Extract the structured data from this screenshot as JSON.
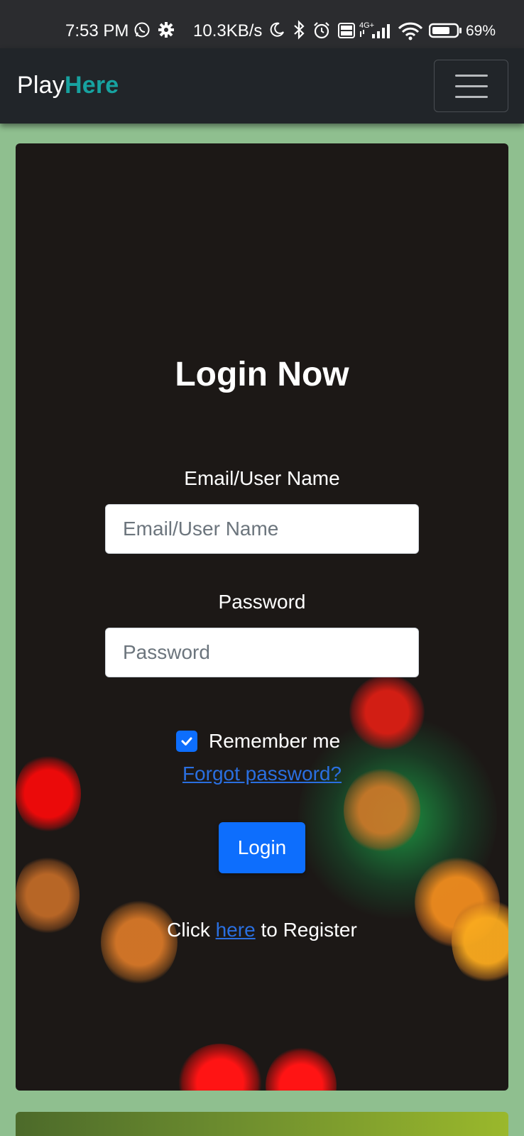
{
  "status_bar": {
    "time": "7:53 PM",
    "speed": "10.3KB/s",
    "network": "4G+",
    "battery": "69%"
  },
  "navbar": {
    "brand_part1": "Play",
    "brand_part2": "Here",
    "accent_color": "#17a2a0"
  },
  "login": {
    "title": "Login Now",
    "email_label": "Email/User Name",
    "email_placeholder": "Email/User Name",
    "password_label": "Password",
    "password_placeholder": "Password",
    "remember_label": "Remember me",
    "remember_checked": true,
    "forgot_link": "Forgot password?",
    "login_button": "Login",
    "register_prefix": "Click",
    "register_link": "here",
    "register_suffix": "to Register"
  },
  "colors": {
    "page_bg": "#8fbf8f",
    "navbar_bg": "#212529",
    "primary": "#0d6efd",
    "link": "#2a6fe0"
  }
}
